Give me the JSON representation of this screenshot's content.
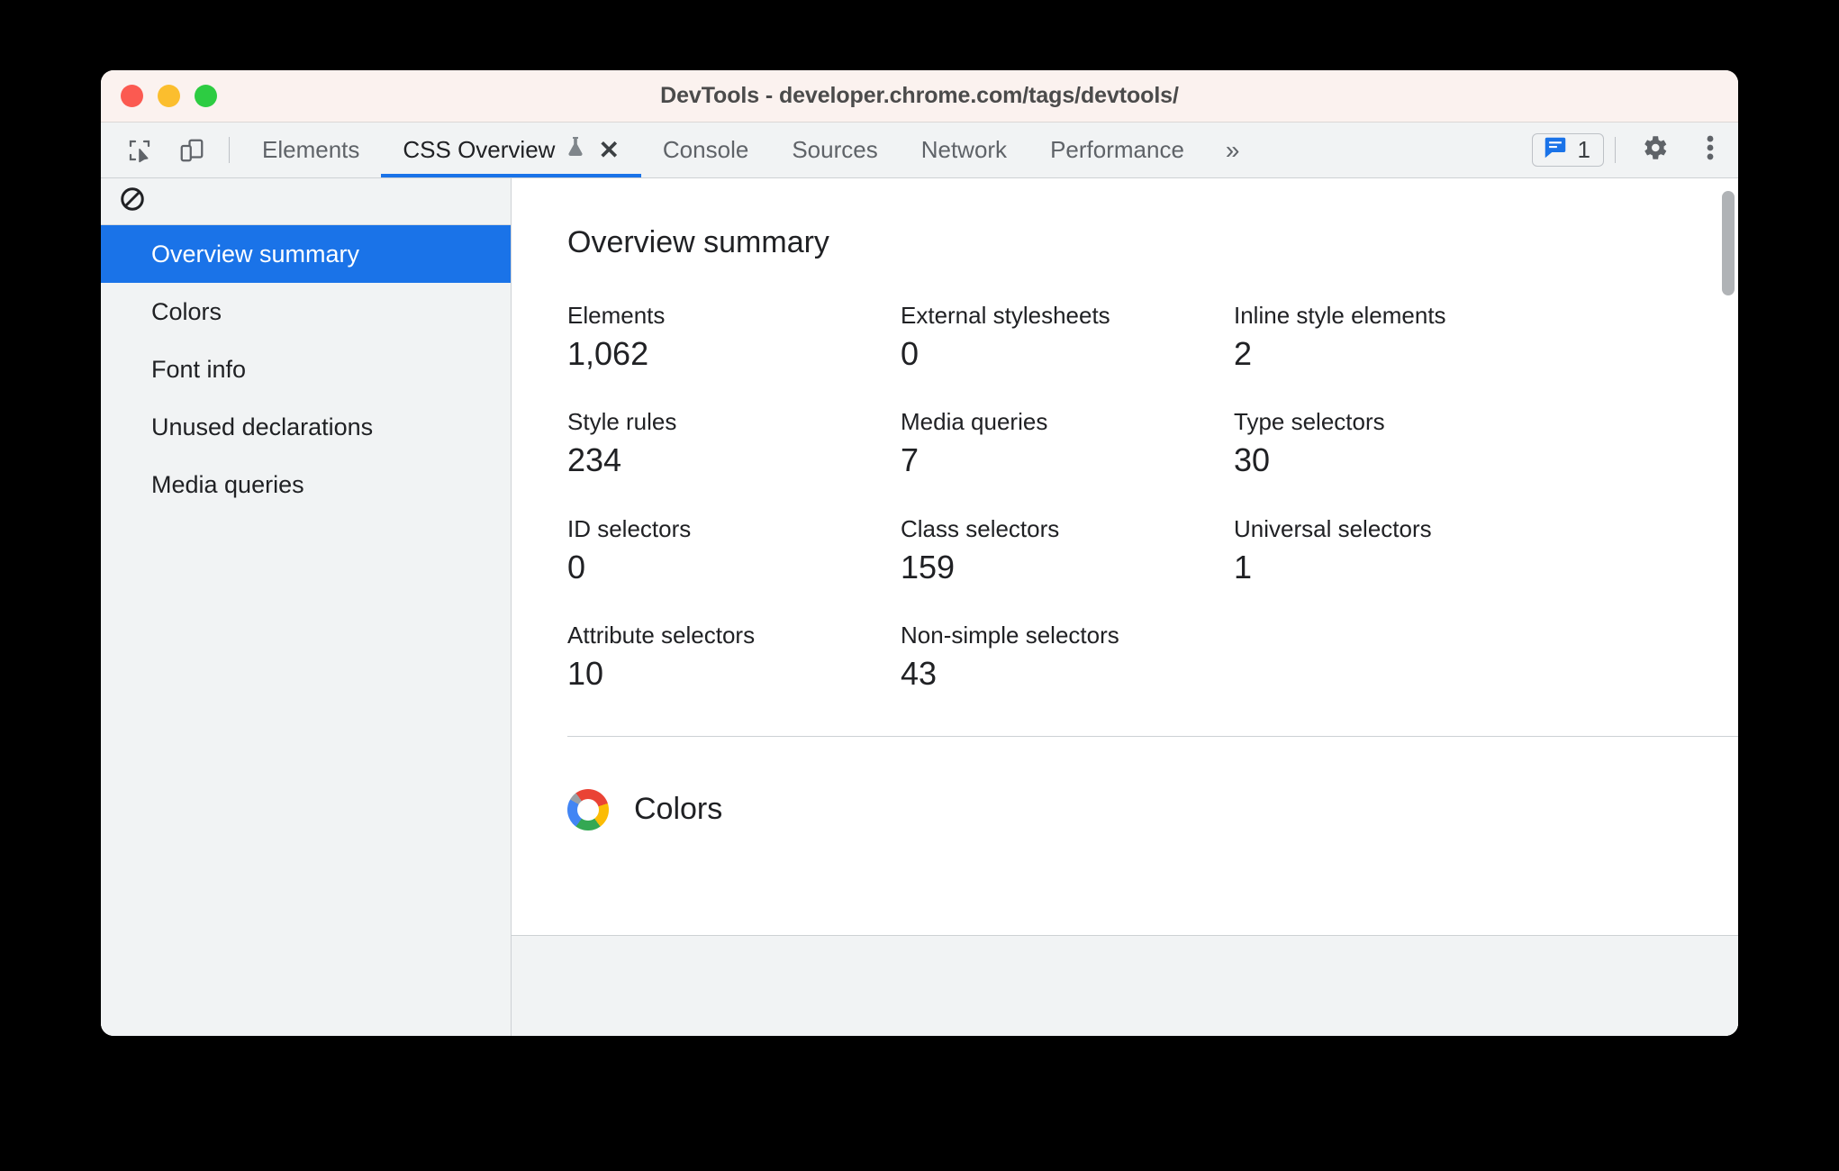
{
  "window": {
    "title": "DevTools - developer.chrome.com/tags/devtools/",
    "traffic_lights": [
      "close",
      "minimize",
      "zoom"
    ]
  },
  "toolbar": {
    "inspect_icon": "inspect-element-icon",
    "device_icon": "device-toolbar-icon",
    "tabs": [
      {
        "label": "Elements",
        "selected": false
      },
      {
        "label": "CSS Overview",
        "selected": true,
        "experimental": true,
        "closable": true
      },
      {
        "label": "Console",
        "selected": false
      },
      {
        "label": "Sources",
        "selected": false
      },
      {
        "label": "Network",
        "selected": false
      },
      {
        "label": "Performance",
        "selected": false
      }
    ],
    "more_tabs_label": "»",
    "issues_count": "1",
    "settings_icon": "gear-icon",
    "more_options_icon": "three-dot-menu-icon",
    "accent_color": "#1a73e8"
  },
  "sidebar": {
    "clear_icon": "block-clear-overview-icon",
    "items": [
      {
        "label": "Overview summary",
        "active": true
      },
      {
        "label": "Colors",
        "active": false
      },
      {
        "label": "Font info",
        "active": false
      },
      {
        "label": "Unused declarations",
        "active": false
      },
      {
        "label": "Media queries",
        "active": false
      }
    ]
  },
  "main": {
    "summary": {
      "title": "Overview summary",
      "stats": [
        {
          "label": "Elements",
          "value": "1,062"
        },
        {
          "label": "External stylesheets",
          "value": "0"
        },
        {
          "label": "Inline style elements",
          "value": "2"
        },
        {
          "label": "Style rules",
          "value": "234"
        },
        {
          "label": "Media queries",
          "value": "7"
        },
        {
          "label": "Type selectors",
          "value": "30"
        },
        {
          "label": "ID selectors",
          "value": "0"
        },
        {
          "label": "Class selectors",
          "value": "159"
        },
        {
          "label": "Universal selectors",
          "value": "1"
        },
        {
          "label": "Attribute selectors",
          "value": "10"
        },
        {
          "label": "Non-simple selectors",
          "value": "43"
        }
      ]
    },
    "colors_section": {
      "title": "Colors",
      "icon": "color-wheel-icon"
    }
  }
}
